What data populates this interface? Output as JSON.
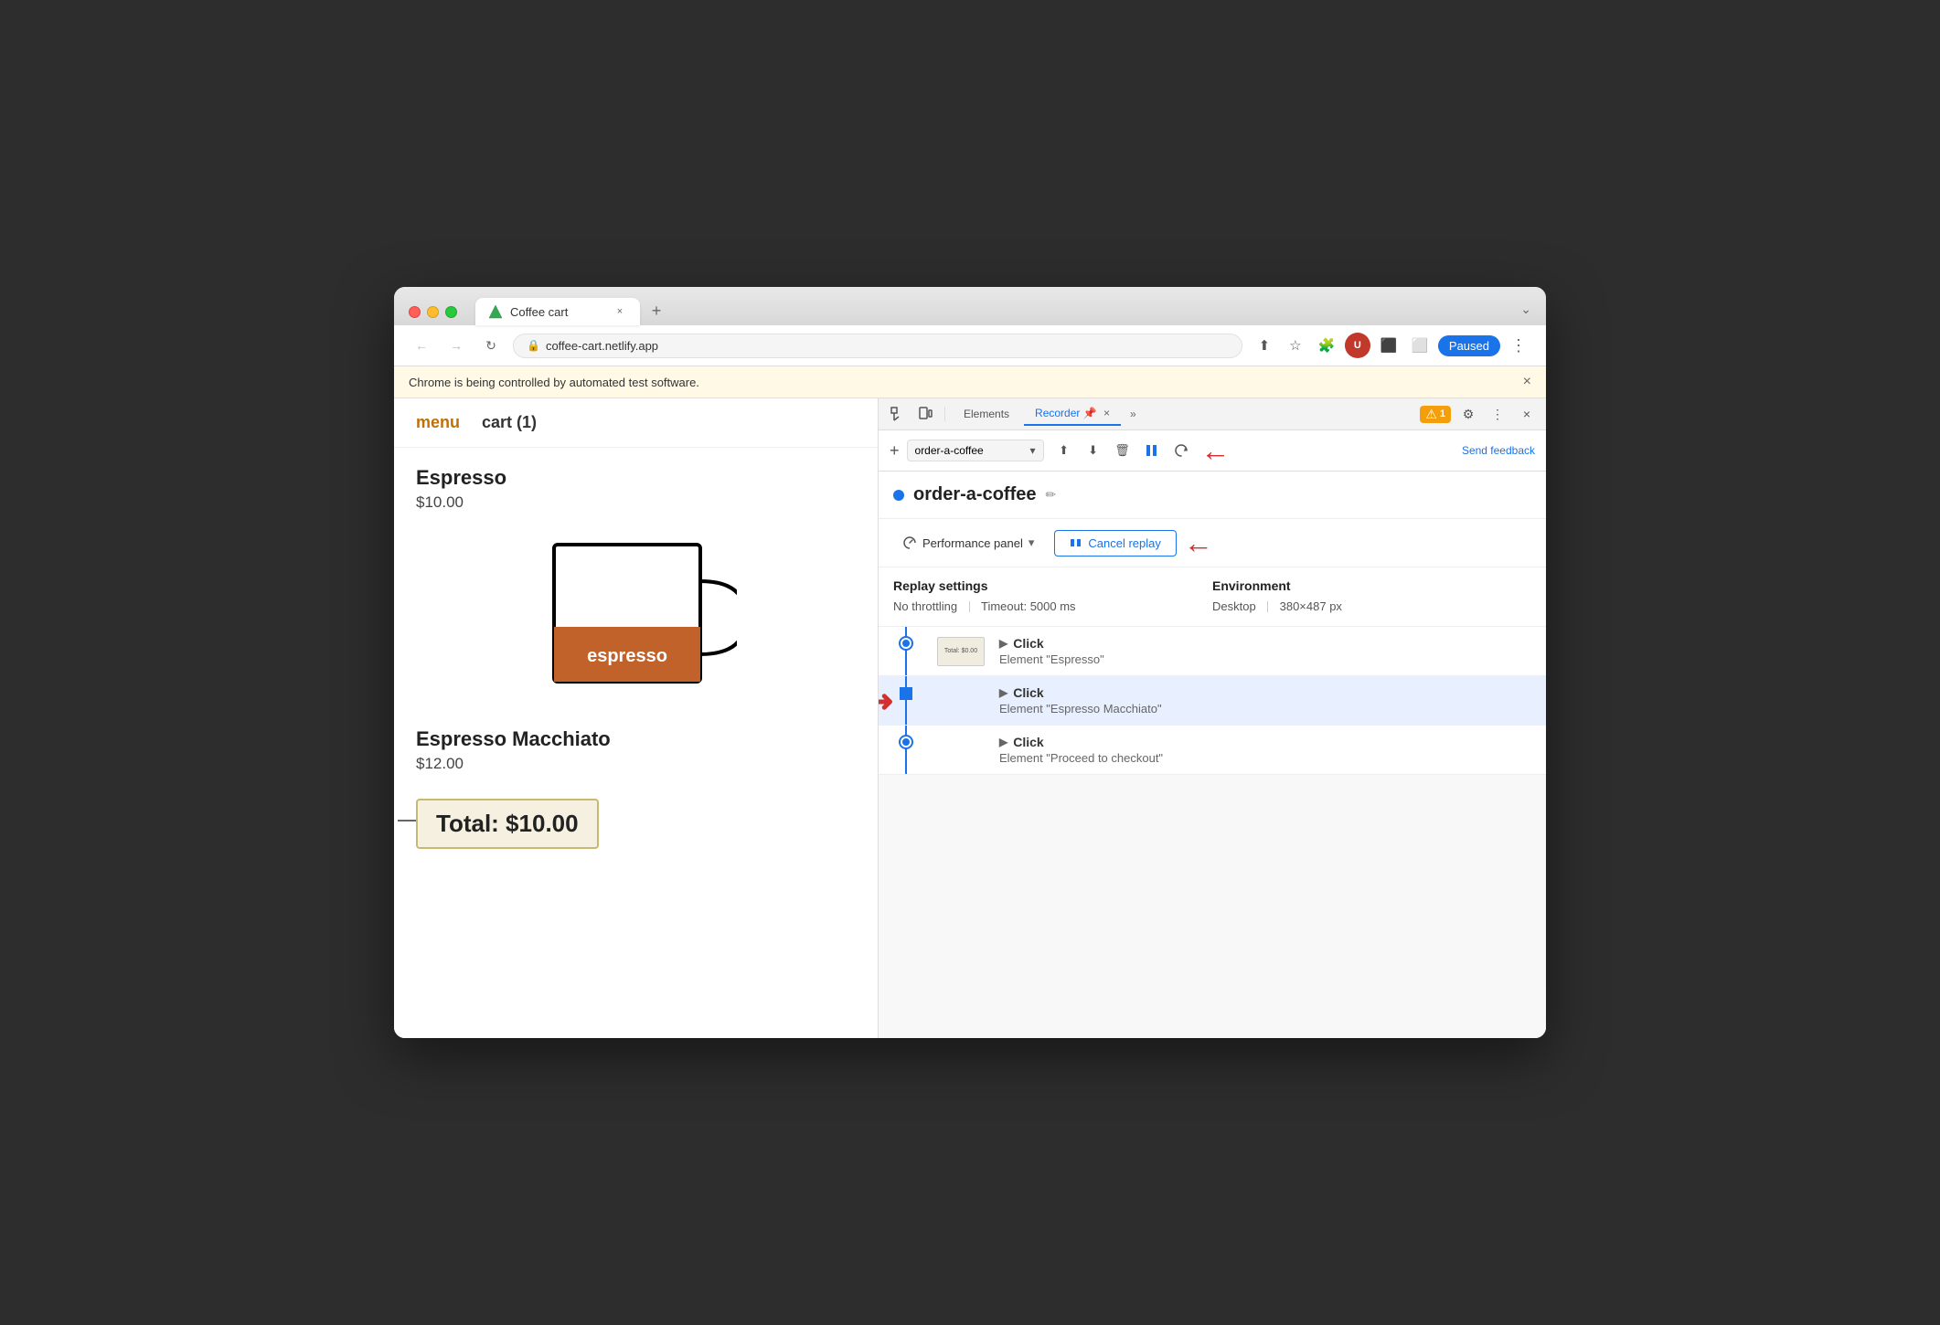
{
  "browser": {
    "traffic_lights": [
      "red",
      "yellow",
      "green"
    ],
    "tab": {
      "title": "Coffee cart",
      "favicon": "V",
      "close_label": "×"
    },
    "new_tab_label": "+",
    "chevron": "⌄",
    "address_bar": {
      "url": "coffee-cart.netlify.app",
      "lock_icon": "🔒"
    },
    "toolbar": {
      "share_icon": "⬆",
      "star_icon": "☆",
      "extensions_icon": "🧩",
      "profile_icon": "👤",
      "cast_icon": "⬛",
      "window_icon": "⬜"
    },
    "paused_label": "Paused",
    "menu_dots": "⋮"
  },
  "notification": {
    "text": "Chrome is being controlled by automated test software.",
    "close": "×"
  },
  "website": {
    "nav": {
      "menu_label": "menu",
      "cart_label": "cart (1)"
    },
    "products": [
      {
        "name": "Espresso",
        "price": "$10.00"
      },
      {
        "name": "Espresso Macchiato",
        "price": "$12.00"
      }
    ],
    "total_label": "Total: $10.00"
  },
  "devtools": {
    "tabs": [
      "Elements",
      "Recorder 📌",
      "»"
    ],
    "recorder_tab_label": "Recorder",
    "recorder_tab_pin": "📌",
    "elements_tab": "Elements",
    "more_tabs": "»",
    "badge_count": "1",
    "icons": {
      "settings": "⚙",
      "more": "⋮",
      "close": "×",
      "inspect": "⬚",
      "device": "⬜"
    },
    "recorder": {
      "add_icon": "+",
      "recording_name": "order-a-coffee",
      "recording_name_placeholder": "order-a-coffee",
      "toolbar_icons": {
        "export": "⬆",
        "import": "⬇",
        "delete": "🗑",
        "replay": "▷",
        "replay2": "↻"
      },
      "send_feedback": "Send feedback",
      "dot_color": "#1a73e8",
      "edit_icon": "✏",
      "performance_panel": "Performance panel",
      "cancel_replay_label": "Cancel replay",
      "pause_icon": "⏸"
    },
    "settings": {
      "replay_settings_label": "Replay settings",
      "environment_label": "Environment",
      "throttling": "No throttling",
      "timeout": "Timeout: 5000 ms",
      "env_type": "Desktop",
      "env_size": "380×487 px"
    },
    "steps": [
      {
        "type": "Click",
        "detail": "Element \"Espresso\"",
        "has_thumbnail": true,
        "highlighted": false,
        "marker": "dot"
      },
      {
        "type": "Click",
        "detail": "Element \"Espresso Macchiato\"",
        "has_thumbnail": false,
        "highlighted": true,
        "marker": "square"
      },
      {
        "type": "Click",
        "detail": "Element \"Proceed to checkout\"",
        "has_thumbnail": false,
        "highlighted": false,
        "marker": "dot"
      }
    ]
  }
}
